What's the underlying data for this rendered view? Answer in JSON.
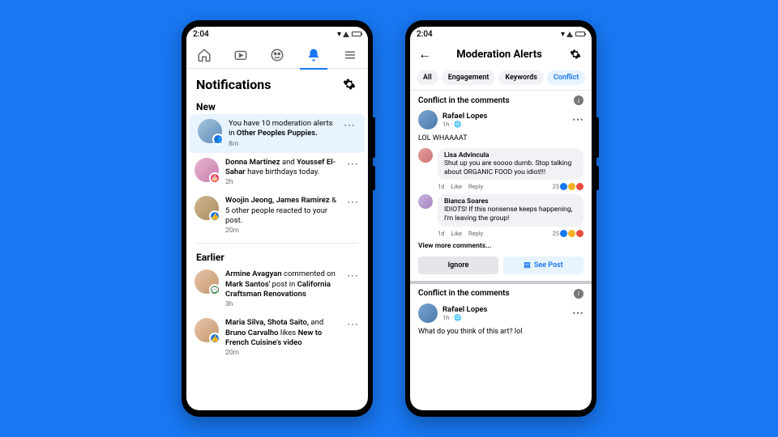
{
  "status": {
    "time": "2:04"
  },
  "phone1": {
    "title": "Notifications",
    "sections": {
      "new": "New",
      "earlier": "Earlier"
    },
    "new_items": [
      {
        "text_pre": "You have 10 moderation alerts in ",
        "bold": "Other Peoples Puppies.",
        "text_post": "",
        "time": "8m"
      },
      {
        "bold1": "Donna Martinez",
        "mid": " and ",
        "bold2": "Youssef El-Sahar",
        "text_post": " have birthdays today.",
        "time": "2h"
      },
      {
        "bold1": "Woojin Jeong, James Ramirez",
        "text_post": " & 5 other people reacted to your post.",
        "time": "20m"
      }
    ],
    "earlier_items": [
      {
        "bold1": "Armine Avagyan",
        "mid": " commented on ",
        "bold2": "Mark Santos'",
        "mid2": " post in ",
        "bold3": "California Craftsman Renovations",
        "time": "3h"
      },
      {
        "bold1": "Maria Silva, Shota Saito,",
        "mid": " and ",
        "bold2": "Bruno Carvalho",
        "mid2": " likes ",
        "bold3": "New to French Cuisine's video",
        "time": "20m"
      }
    ]
  },
  "phone2": {
    "title": "Moderation Alerts",
    "filters": {
      "all": "All",
      "engagement": "Engagement",
      "keywords": "Keywords",
      "conflict": "Conflict"
    },
    "card_title": "Conflict in the comments",
    "post_author": "Rafael Lopes",
    "post_meta": "1h ·",
    "post_text": "LOL WHAAAAT",
    "comments": [
      {
        "name": "Lisa Advincula",
        "text": "Shut up you are soooo dumb. Stop talking about ORGANIC FOOD you idiot!!!",
        "time": "1d",
        "like": "Like",
        "reply": "Reply",
        "count": "25"
      },
      {
        "name": "Bianca Soares",
        "text": "IDIOTS! If this nonsense keeps happening, I'm leaving the group!",
        "time": "1d",
        "like": "Like",
        "reply": "Reply",
        "count": "25"
      }
    ],
    "view_more": "View more comments...",
    "actions": {
      "ignore": "Ignore",
      "seepost": "See Post"
    },
    "card2_title": "Conflict in the comments",
    "card2_author": "Rafael Lopes",
    "card2_meta": "1h ·",
    "card2_text": "What do you think of this art? lol"
  }
}
